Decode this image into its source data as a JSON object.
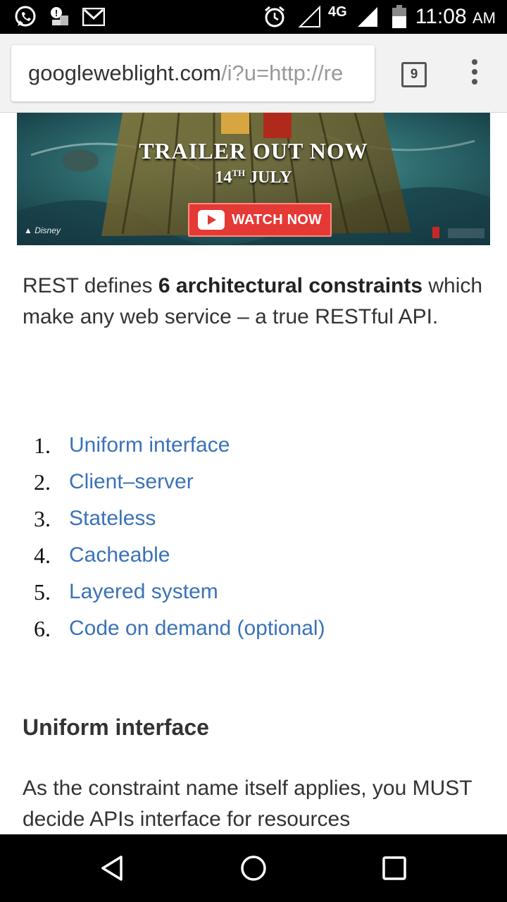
{
  "status_bar": {
    "time": "11:08",
    "ampm": "AM",
    "network": "4G",
    "icons": [
      "whatsapp-icon",
      "notification-icon",
      "gmail-icon",
      "alarm-icon",
      "signal-empty-icon",
      "signal-icon",
      "battery-icon"
    ]
  },
  "browser": {
    "url_host": "googleweblight.com",
    "url_path": "/i?u=http://re",
    "tab_count": "9"
  },
  "banner": {
    "headline": "TRAILER OUT NOW",
    "date_prefix": "14",
    "date_suffix": "TH",
    "date_month": "JULY",
    "button_label": "WATCH NOW"
  },
  "article": {
    "intro_before": "REST defines ",
    "intro_bold": "6 architectural constraints",
    "intro_after": " which make any web service – a true RESTful API.",
    "constraints": [
      {
        "num": "1.",
        "label": "Uniform interface"
      },
      {
        "num": "2.",
        "label": "Client–server"
      },
      {
        "num": "3.",
        "label": "Stateless"
      },
      {
        "num": "4.",
        "label": "Cacheable"
      },
      {
        "num": "5.",
        "label": "Layered system"
      },
      {
        "num": "6.",
        "label": "Code on demand (optional)"
      }
    ],
    "section_heading": "Uniform interface",
    "body_text": "As the constraint name itself applies, you MUST decide APIs interface for resources"
  },
  "colors": {
    "link": "#3a72b8",
    "text": "#333333",
    "watch_button": "#e53935"
  }
}
